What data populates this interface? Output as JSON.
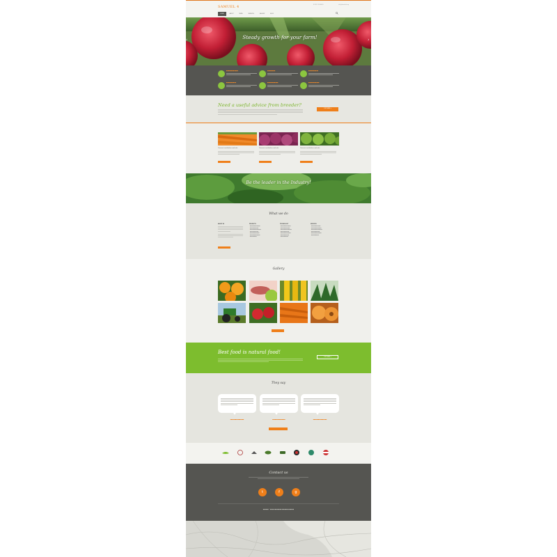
{
  "header": {
    "logo": "SAMUEL 4",
    "phone": "8 (333) 333-44-55",
    "email": "info@demolink.org",
    "nav": [
      "HOME",
      "ABOUT",
      "NEWS",
      "SERVICES",
      "GALLERY",
      "BLOG"
    ]
  },
  "hero": {
    "title": "Steady growth for your farm!"
  },
  "advice": {
    "title": "Need a useful advice from breeder?",
    "button": "CLICK HERE +"
  },
  "products": [
    {
      "caption": "Praesent vestibulum molestie"
    },
    {
      "caption": "Praesent vestibulum molestie"
    },
    {
      "caption": "Praesent vestibulum molestie"
    }
  ],
  "banner": {
    "title": "Be the leader in the Industry!"
  },
  "what_we_do": {
    "title": "What we do",
    "columns": [
      "ABOUT US",
      "PRODUCTS",
      "TECHNOLOGY",
      "SERVICES"
    ]
  },
  "gallery": {
    "title": "Gallery"
  },
  "cta": {
    "title": "Best food is natural food!",
    "button": "CLICK HERE +"
  },
  "testimonials": {
    "title": "They say"
  },
  "contact": {
    "title": "Contact us"
  },
  "colors": {
    "accent": "#ef7f1a",
    "green": "#7dbd2e",
    "dark": "#555551"
  }
}
